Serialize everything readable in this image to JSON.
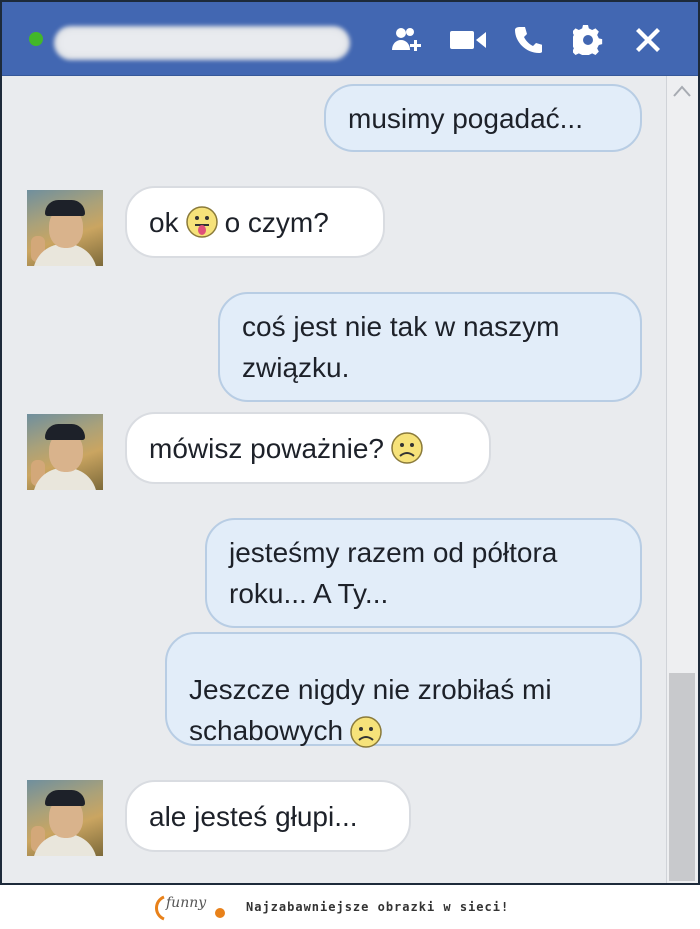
{
  "header": {
    "contact_name_blurred": "",
    "icons": [
      "add-people-icon",
      "video-call-icon",
      "phone-call-icon",
      "settings-gear-icon",
      "close-icon"
    ],
    "accent_color": "#4267b2",
    "online_color": "#42b72a"
  },
  "messages": [
    {
      "direction": "out",
      "text": "musimy pogadać..."
    },
    {
      "direction": "in",
      "before": "ok",
      "emoji": "tongue-face-emoji",
      "after": "o czym?"
    },
    {
      "direction": "out",
      "text": "coś jest nie tak w naszym\nzwiązku."
    },
    {
      "direction": "in",
      "before": "mówisz poważnie?",
      "emoji": "sad-face-emoji",
      "after": ""
    },
    {
      "direction": "out",
      "text": "jesteśmy razem od półtora\nroku... A Ty..."
    },
    {
      "direction": "out",
      "before": "Jeszcze nigdy nie zrobiłaś mi\nschabowych",
      "emoji": "sad-face-emoji",
      "after": ""
    },
    {
      "direction": "in",
      "text": "ale jesteś głupi..."
    }
  ],
  "footer": {
    "logo_text": "funny",
    "tagline": "Najzabawniejsze obrazki w sieci!"
  }
}
